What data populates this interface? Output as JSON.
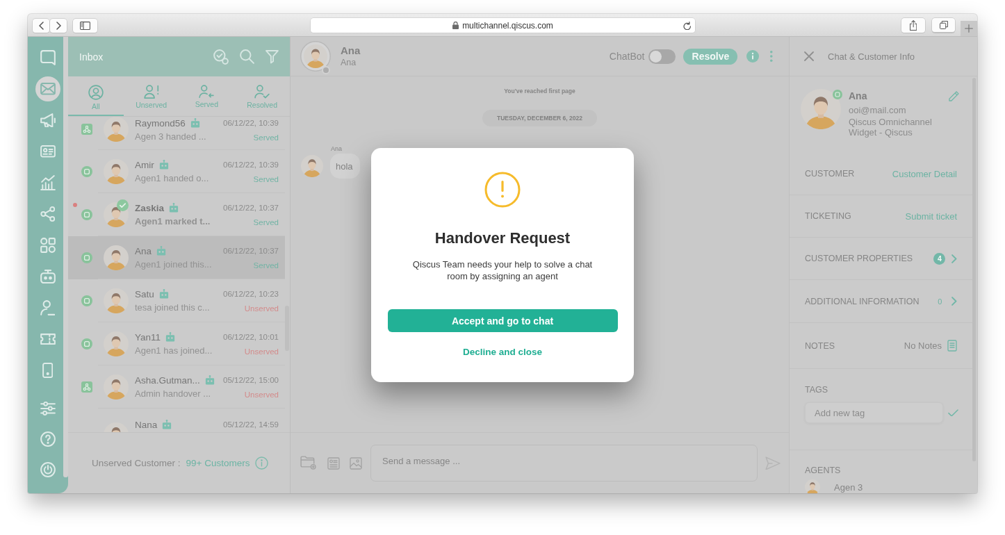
{
  "browser": {
    "url": "multichannel.qiscus.com"
  },
  "nav": {
    "items": [
      {
        "selected": false
      },
      {
        "selected": true
      },
      {
        "selected": false
      },
      {
        "selected": false
      },
      {
        "selected": false
      },
      {
        "selected": false
      },
      {
        "selected": false
      },
      {
        "selected": false
      },
      {
        "selected": false
      },
      {
        "selected": false
      },
      {
        "selected": false
      }
    ],
    "bottom_items": [
      {
        "selected": false
      },
      {
        "selected": false
      },
      {
        "selected": false
      }
    ]
  },
  "inbox": {
    "title": "Inbox",
    "tabs": [
      {
        "label": "All",
        "selected": true
      },
      {
        "label": "Unserved",
        "selected": false
      },
      {
        "label": "Served",
        "selected": false
      },
      {
        "label": "Resolved",
        "selected": false
      }
    ],
    "conversations": [
      {
        "kind": "custom",
        "name": "Raymond56",
        "bot": true,
        "time": "06/12/22, 10:39",
        "preview": "Agen 3 handed ...",
        "status": {
          "text": "Served",
          "color": "#72b4a5"
        },
        "unread": false,
        "checked": false,
        "selected": false
      },
      {
        "kind": "widget",
        "name": "Amir",
        "bot": true,
        "time": "06/12/22, 10:39",
        "preview": "Agen1 handed o...",
        "status": {
          "text": "Served",
          "color": "#72b4a5"
        },
        "unread": false,
        "checked": false,
        "selected": false
      },
      {
        "kind": "widget",
        "name": "Zaskia",
        "bot": true,
        "time": "06/12/22, 10:37",
        "preview": "Agen1 marked t...",
        "status": {
          "text": "Served",
          "color": "#72b4a5"
        },
        "unread": true,
        "checked": true,
        "selected": false
      },
      {
        "kind": "widget",
        "name": "Ana",
        "bot": true,
        "time": "06/12/22, 10:37",
        "preview": "Agen1 joined this...",
        "status": {
          "text": "Served",
          "color": "#72b4a5"
        },
        "unread": false,
        "checked": false,
        "selected": true
      },
      {
        "kind": "widget",
        "name": "Satu",
        "bot": true,
        "time": "06/12/22, 10:23",
        "preview": "tesa joined this c...",
        "status": {
          "text": "Unserved",
          "color": "#d38b8b"
        },
        "unread": false,
        "checked": false,
        "selected": false
      },
      {
        "kind": "widget",
        "name": "Yan11",
        "bot": true,
        "time": "06/12/22, 10:01",
        "preview": "Agen1 has joined...",
        "status": {
          "text": "Unserved",
          "color": "#d38b8b"
        },
        "unread": false,
        "checked": false,
        "selected": false
      },
      {
        "kind": "custom",
        "name": "Asha.Gutman...",
        "bot": true,
        "time": "05/12/22, 15:00",
        "preview": "Admin handover ...",
        "status": {
          "text": "Unserved",
          "color": "#d38b8b"
        },
        "unread": false,
        "checked": false,
        "selected": false
      },
      {
        "name": "Nana",
        "bot": true,
        "time": "05/12/22, 14:59",
        "unread": false,
        "checked": false,
        "selected": false
      }
    ],
    "footer": {
      "label": "Unserved Customer :",
      "value": "99+ Customers"
    }
  },
  "chat": {
    "contact": {
      "name": "Ana",
      "subtitle": "Ana",
      "online": false
    },
    "chatbot": {
      "label": "ChatBot",
      "on": false
    },
    "resolve": "Resolve",
    "notice": "You've reached first page",
    "date": "TUESDAY, DECEMBER 6, 2022",
    "messages": [
      {
        "sender": "Ana",
        "text": "hola"
      }
    ],
    "composer": {
      "placeholder": "Send a message ..."
    }
  },
  "info_panel": {
    "title": "Chat & Customer Info",
    "customer": {
      "name": "Ana",
      "email": "ooi@mail.com",
      "channel": "Qiscus Omnichannel Widget - Qiscus"
    },
    "sections": [
      {
        "kind": "link",
        "label": "CUSTOMER",
        "action": "Customer Detail"
      },
      {
        "kind": "link",
        "label": "TICKETING",
        "action": "Submit ticket"
      },
      {
        "kind": "badge",
        "label": "CUSTOMER PROPERTIES",
        "count": "4"
      },
      {
        "kind": "count",
        "label": "ADDITIONAL INFORMATION",
        "count": "0"
      },
      {
        "kind": "notes",
        "label": "NOTES",
        "value": "No Notes"
      },
      {
        "kind": "tags",
        "label": "TAGS",
        "placeholder": "Add new tag"
      },
      {
        "kind": "agents",
        "label": "AGENTS",
        "agents": [
          {
            "name": "Agen 3"
          }
        ]
      }
    ]
  },
  "modal": {
    "title": "Handover Request",
    "message": "Qiscus Team needs your help to solve a chat room by assigning an agent",
    "accept": "Accept and go to chat",
    "decline": "Decline and close"
  }
}
